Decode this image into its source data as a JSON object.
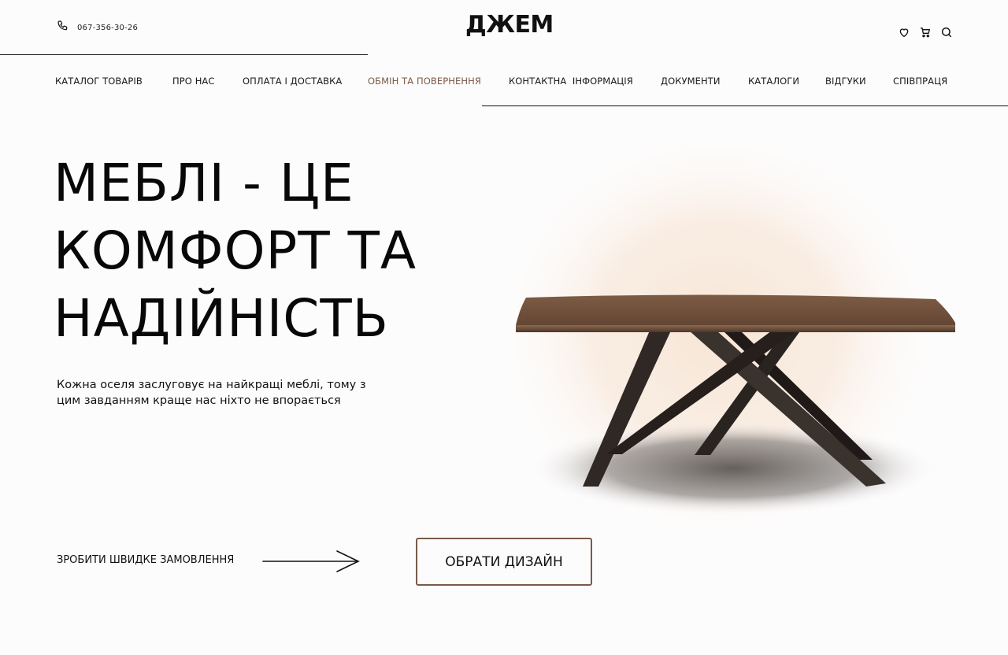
{
  "header": {
    "phone": "067-356-30-26",
    "logo": "ДЖЕМ",
    "icons": [
      "heart-icon",
      "cart-icon",
      "search-icon"
    ]
  },
  "nav": {
    "items": [
      {
        "label": "КАТАЛОГ ТОВАРІВ"
      },
      {
        "label": "ПРО НАС"
      },
      {
        "label": "ОПЛАТА І ДОСТАВКА"
      },
      {
        "label": "ОБМІН ТА ПОВЕРНЕННЯ"
      },
      {
        "label": "КОНТАКТНА  ІНФОРМАЦІЯ"
      },
      {
        "label": "ДОКУМЕНТИ"
      },
      {
        "label": "КАТАЛОГИ"
      },
      {
        "label": "ВІДГУКИ"
      },
      {
        "label": "СПІВПРАЦЯ"
      }
    ],
    "active_label": "ОБМІН ТА ПОВЕРНЕННЯ"
  },
  "hero": {
    "title_lines": [
      "МЕБЛІ - ЦЕ",
      "КОМФОРТ ТА",
      "НАДІЙНІСТЬ"
    ],
    "subtitle": "Кожна оселя заслуговує  на найкращі меблі, тому з цим завданням краще нас ніхто не впорається",
    "quick_order_label": "ЗРОБИТИ ШВИДКЕ ЗАМОВЛЕННЯ",
    "design_button_label": "ОБРАТИ ДИЗАЙН"
  },
  "colors": {
    "accent": "#7a5a45",
    "text": "#111111",
    "background": "#fdfcfc",
    "wood": "#6b4c38",
    "legs": "#2f2824"
  }
}
